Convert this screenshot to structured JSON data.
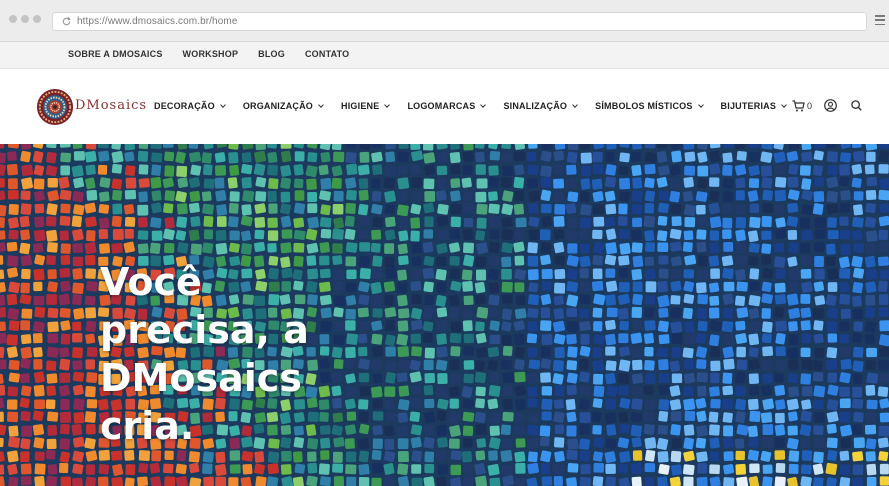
{
  "browser": {
    "url": "https://www.dmosaics.com.br/home"
  },
  "topbar": {
    "links": [
      "SOBRE A DMOSAICS",
      "WORKSHOP",
      "BLOG",
      "CONTATO"
    ]
  },
  "header": {
    "logo_text": "DMosaics",
    "nav": [
      "DECORAÇÃO",
      "ORGANIZAÇÃO",
      "HIGIENE",
      "LOGOMARCAS",
      "SINALIZAÇÃO",
      "SÍMBOLOS MÍSTICOS",
      "BIJUTERIAS"
    ],
    "cart_count": "0",
    "icons": [
      "cart-icon",
      "user-icon",
      "search-icon"
    ]
  },
  "hero": {
    "lines": [
      "Você",
      "precisa, a",
      "DMosaics",
      "cria."
    ]
  }
}
